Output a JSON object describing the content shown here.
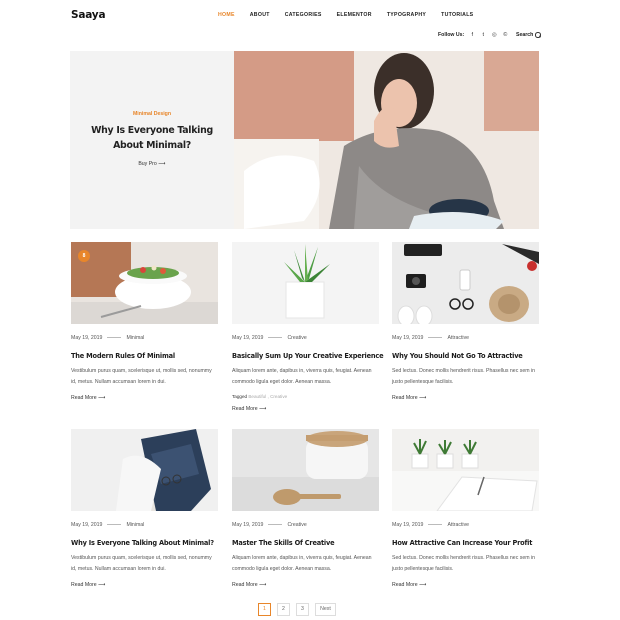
{
  "site": {
    "logo": "Saaya"
  },
  "nav": [
    "HOME",
    "ABOUT",
    "CATEGORIES",
    "ELEMENTOR",
    "TYPOGRAPHY",
    "TUTORIALS"
  ],
  "follow": {
    "label": "Follow Us:",
    "icons": [
      "facebook-icon",
      "twitter-icon",
      "instagram-icon",
      "whatsapp-icon"
    ],
    "glyphs": [
      "f",
      "t",
      "◎",
      "©"
    ]
  },
  "search": {
    "label": "Search"
  },
  "hero": {
    "category": "Minimal Design",
    "title": "Why Is Everyone Talking About Minimal?",
    "button": "Buy Pro"
  },
  "posts": [
    {
      "date": "May 19, 2019",
      "category": "Minimal",
      "title": "The Modern Rules Of Minimal",
      "excerpt": "Vestibulum purus quam, scelerisque ut, mollis sed, nonummy id, metus. Nullam accumsan lorem in dui.",
      "read": "Read More",
      "badge": "8"
    },
    {
      "date": "May 19, 2019",
      "category": "Creative",
      "title": "Basically Sum Up Your Creative Experience",
      "excerpt": "Aliquam lorem ante, dapibus in, viverra quis, feugiat. Aenean commodo ligula eget dolor. Aenean massa.",
      "tags_label": "Tagged",
      "tags": "Beautiful , Creative",
      "read": "Read More"
    },
    {
      "date": "May 19, 2019",
      "category": "Attractive",
      "title": "Why You Should Not Go To Attractive",
      "excerpt": "Sed lectus. Donec mollis hendrerit risus. Phasellus nec sem in justo pellentesque facilisis.",
      "read": "Read More"
    },
    {
      "date": "May 19, 2019",
      "category": "Minimal",
      "title": "Why Is Everyone Talking About Minimal?",
      "excerpt": "Vestibulum purus quam, scelerisque ut, mollis sed, nonummy id, metus. Nullam accumsan lorem in dui.",
      "read": "Read More"
    },
    {
      "date": "May 19, 2019",
      "category": "Creative",
      "title": "Master The Skills Of Creative",
      "excerpt": "Aliquam lorem ante, dapibus in, viverra quis, feugiat. Aenean commodo ligula eget dolor. Aenean massa.",
      "read": "Read More"
    },
    {
      "date": "May 19, 2019",
      "category": "Attractive",
      "title": "How Attractive Can Increase Your Profit",
      "excerpt": "Sed lectus. Donec mollis hendrerit risus. Phasellus nec sem in justo pellentesque facilisis.",
      "read": "Read More"
    }
  ],
  "pagination": {
    "pages": [
      "1",
      "2",
      "3"
    ],
    "next": "Next",
    "current": "1"
  },
  "colors": {
    "accent": "#e8862a",
    "text": "#222222",
    "muted": "#555555"
  }
}
